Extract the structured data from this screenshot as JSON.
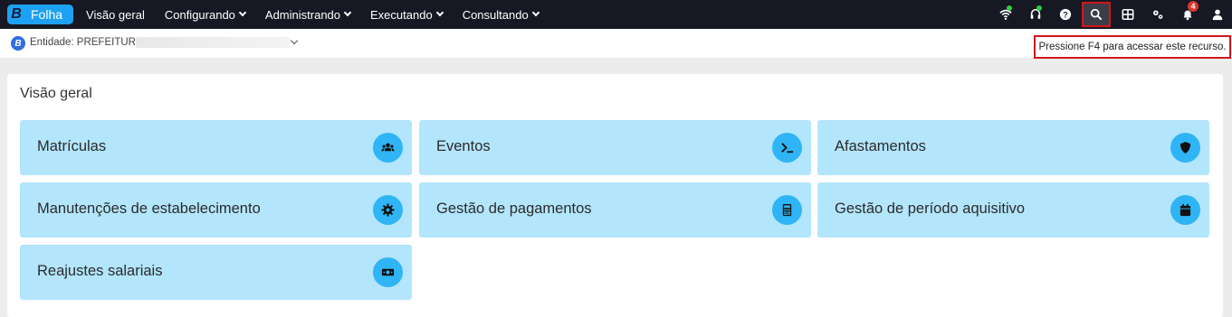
{
  "brand": {
    "logo_letter": "B",
    "name": "Folha"
  },
  "nav": [
    {
      "label": "Visão geral",
      "dropdown": false
    },
    {
      "label": "Configurando",
      "dropdown": true
    },
    {
      "label": "Administrando",
      "dropdown": true
    },
    {
      "label": "Executando",
      "dropdown": true
    },
    {
      "label": "Consultando",
      "dropdown": true
    }
  ],
  "top_icons": [
    "wifi-icon",
    "headset-icon",
    "help-icon",
    "search-icon",
    "grid-icon",
    "gears-icon",
    "bell-icon",
    "user-icon"
  ],
  "notifications_count": "4",
  "entity": {
    "logo_letter": "B",
    "label": "Entidade: PREFEITURA"
  },
  "tooltip": "Pressione F4 para acessar este recurso.",
  "overview": {
    "title": "Visão geral",
    "tiles": [
      {
        "label": "Matrículas",
        "icon": "users-icon"
      },
      {
        "label": "Eventos",
        "icon": "terminal-icon"
      },
      {
        "label": "Afastamentos",
        "icon": "shield-icon"
      },
      {
        "label": "Manutenções de estabelecimento",
        "icon": "gear-icon"
      },
      {
        "label": "Gestão de pagamentos",
        "icon": "calculator-icon"
      },
      {
        "label": "Gestão de período aquisitivo",
        "icon": "calendar-icon"
      },
      {
        "label": "Reajustes salariais",
        "icon": "money-icon"
      }
    ]
  },
  "colors": {
    "topbar": "#161823",
    "brand": "#1ea1f2",
    "tile": "#b3e5fc",
    "tile_icon": "#2fb5f5",
    "highlight": "#d3151b"
  }
}
